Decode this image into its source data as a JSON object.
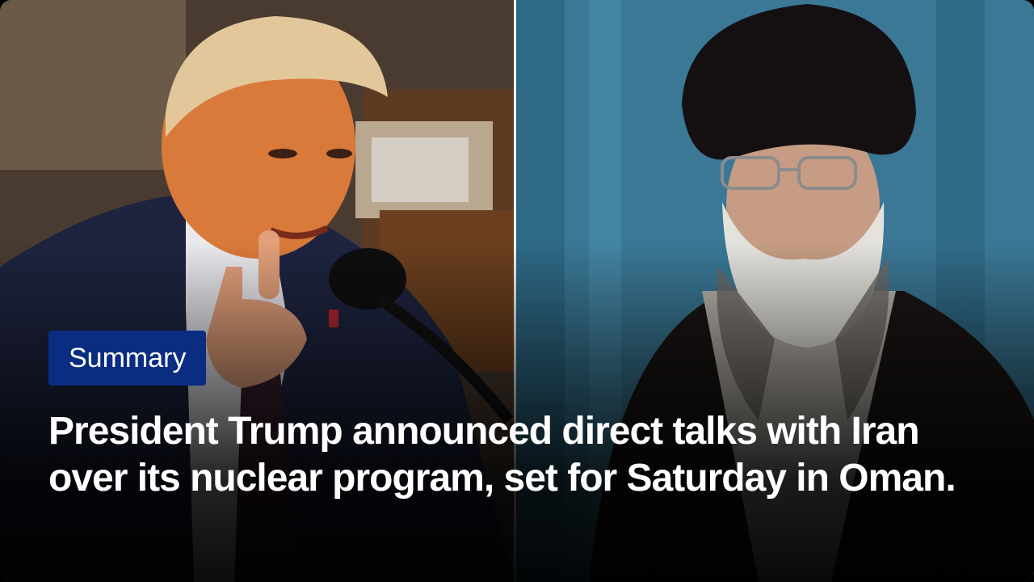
{
  "badge": {
    "label": "Summary"
  },
  "headline": {
    "text": "President Trump announced direct talks with Iran over its nuclear program, set for Saturday in Oman."
  },
  "images": {
    "left": "photo of Donald Trump speaking at a microphone, pointing his finger",
    "right": "photo of Ayatollah Ali Khamenei wearing a black turban and glasses"
  },
  "colors": {
    "badge_bg": "#0a2d82",
    "headline": "#ffffff",
    "divider": "#f2f2f2"
  }
}
